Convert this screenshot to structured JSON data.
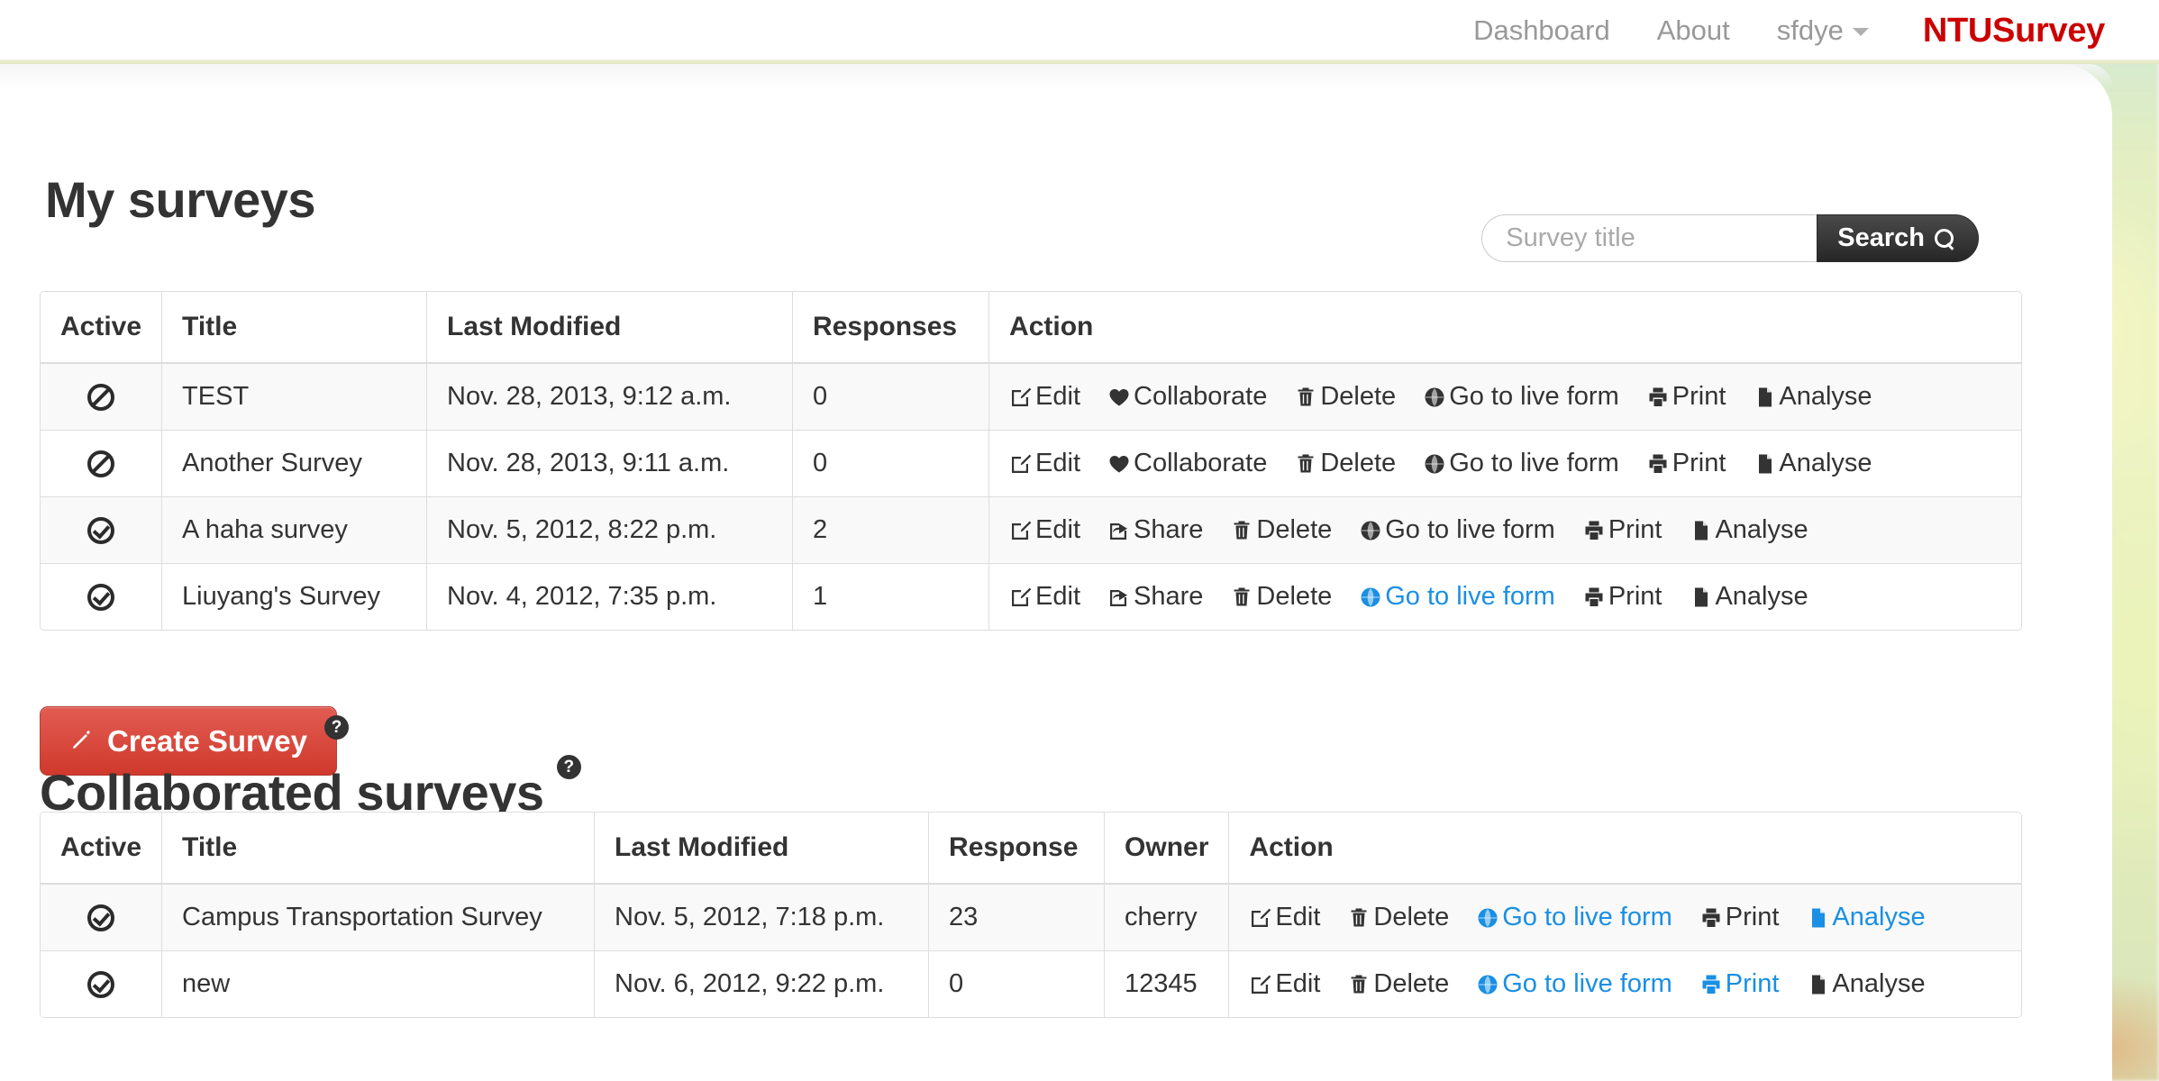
{
  "navbar": {
    "links": [
      {
        "label": "Dashboard",
        "name": "nav-dashboard"
      },
      {
        "label": "About",
        "name": "nav-about"
      },
      {
        "label": "sfdye",
        "name": "nav-user-menu"
      }
    ],
    "brand": "NTUSurvey"
  },
  "search": {
    "placeholder": "Survey title",
    "value": "",
    "button_label": "Search"
  },
  "my_surveys": {
    "title": "My surveys",
    "columns": [
      "Active",
      "Title",
      "Last Modified",
      "Responses",
      "Action"
    ],
    "rows": [
      {
        "active": "banned",
        "title": "TEST",
        "last_modified": "Nov. 28, 2013, 9:12 a.m.",
        "responses": "0",
        "actions": [
          {
            "label": "Edit",
            "icon": "edit-icon",
            "linked": false
          },
          {
            "label": "Collaborate",
            "icon": "heart-icon",
            "linked": false
          },
          {
            "label": "Delete",
            "icon": "trash-icon",
            "linked": false
          },
          {
            "label": "Go to live form",
            "icon": "globe-icon",
            "linked": false
          },
          {
            "label": "Print",
            "icon": "print-icon",
            "linked": false
          },
          {
            "label": "Analyse",
            "icon": "file-icon",
            "linked": false
          }
        ]
      },
      {
        "active": "banned",
        "title": "Another Survey",
        "last_modified": "Nov. 28, 2013, 9:11 a.m.",
        "responses": "0",
        "actions": [
          {
            "label": "Edit",
            "icon": "edit-icon",
            "linked": false
          },
          {
            "label": "Collaborate",
            "icon": "heart-icon",
            "linked": false
          },
          {
            "label": "Delete",
            "icon": "trash-icon",
            "linked": false
          },
          {
            "label": "Go to live form",
            "icon": "globe-icon",
            "linked": false
          },
          {
            "label": "Print",
            "icon": "print-icon",
            "linked": false
          },
          {
            "label": "Analyse",
            "icon": "file-icon",
            "linked": false
          }
        ]
      },
      {
        "active": "checked",
        "title": "A haha survey",
        "last_modified": "Nov. 5, 2012, 8:22 p.m.",
        "responses": "2",
        "actions": [
          {
            "label": "Edit",
            "icon": "edit-icon",
            "linked": false
          },
          {
            "label": "Share",
            "icon": "share-icon",
            "linked": false
          },
          {
            "label": "Delete",
            "icon": "trash-icon",
            "linked": false
          },
          {
            "label": "Go to live form",
            "icon": "globe-icon",
            "linked": false
          },
          {
            "label": "Print",
            "icon": "print-icon",
            "linked": false
          },
          {
            "label": "Analyse",
            "icon": "file-icon",
            "linked": false
          }
        ]
      },
      {
        "active": "checked",
        "title": "Liuyang's Survey",
        "last_modified": "Nov. 4, 2012, 7:35 p.m.",
        "responses": "1",
        "actions": [
          {
            "label": "Edit",
            "icon": "edit-icon",
            "linked": false
          },
          {
            "label": "Share",
            "icon": "share-icon",
            "linked": false
          },
          {
            "label": "Delete",
            "icon": "trash-icon",
            "linked": false
          },
          {
            "label": "Go to live form",
            "icon": "globe-icon",
            "linked": true
          },
          {
            "label": "Print",
            "icon": "print-icon",
            "linked": false
          },
          {
            "label": "Analyse",
            "icon": "file-icon",
            "linked": false
          }
        ]
      }
    ]
  },
  "create_survey": {
    "label": "Create Survey",
    "icon": "pencil-icon",
    "help": "?"
  },
  "collaborated_surveys": {
    "title": "Collaborated surveys",
    "help": "?",
    "columns": [
      "Active",
      "Title",
      "Last Modified",
      "Response",
      "Owner",
      "Action"
    ],
    "rows": [
      {
        "active": "checked",
        "title": "Campus Transportation Survey",
        "last_modified": "Nov. 5, 2012, 7:18 p.m.",
        "response": "23",
        "owner": "cherry",
        "actions": [
          {
            "label": "Edit",
            "icon": "edit-icon",
            "linked": false
          },
          {
            "label": "Delete",
            "icon": "trash-icon",
            "linked": false
          },
          {
            "label": "Go to live form",
            "icon": "globe-icon",
            "linked": true
          },
          {
            "label": "Print",
            "icon": "print-icon",
            "linked": false
          },
          {
            "label": "Analyse",
            "icon": "file-icon",
            "linked": true
          }
        ]
      },
      {
        "active": "checked",
        "title": "new",
        "last_modified": "Nov. 6, 2012, 9:22 p.m.",
        "response": "0",
        "owner": "12345",
        "actions": [
          {
            "label": "Edit",
            "icon": "edit-icon",
            "linked": false
          },
          {
            "label": "Delete",
            "icon": "trash-icon",
            "linked": false
          },
          {
            "label": "Go to live form",
            "icon": "globe-icon",
            "linked": true
          },
          {
            "label": "Print",
            "icon": "print-icon",
            "linked": true
          },
          {
            "label": "Analyse",
            "icon": "file-icon",
            "linked": false
          }
        ]
      }
    ]
  },
  "colors": {
    "brand_red": "#cc0000",
    "button_red": "#d0392c",
    "link_blue": "#1a8fe3",
    "text_dark": "#333333",
    "nav_gray": "#999999"
  }
}
